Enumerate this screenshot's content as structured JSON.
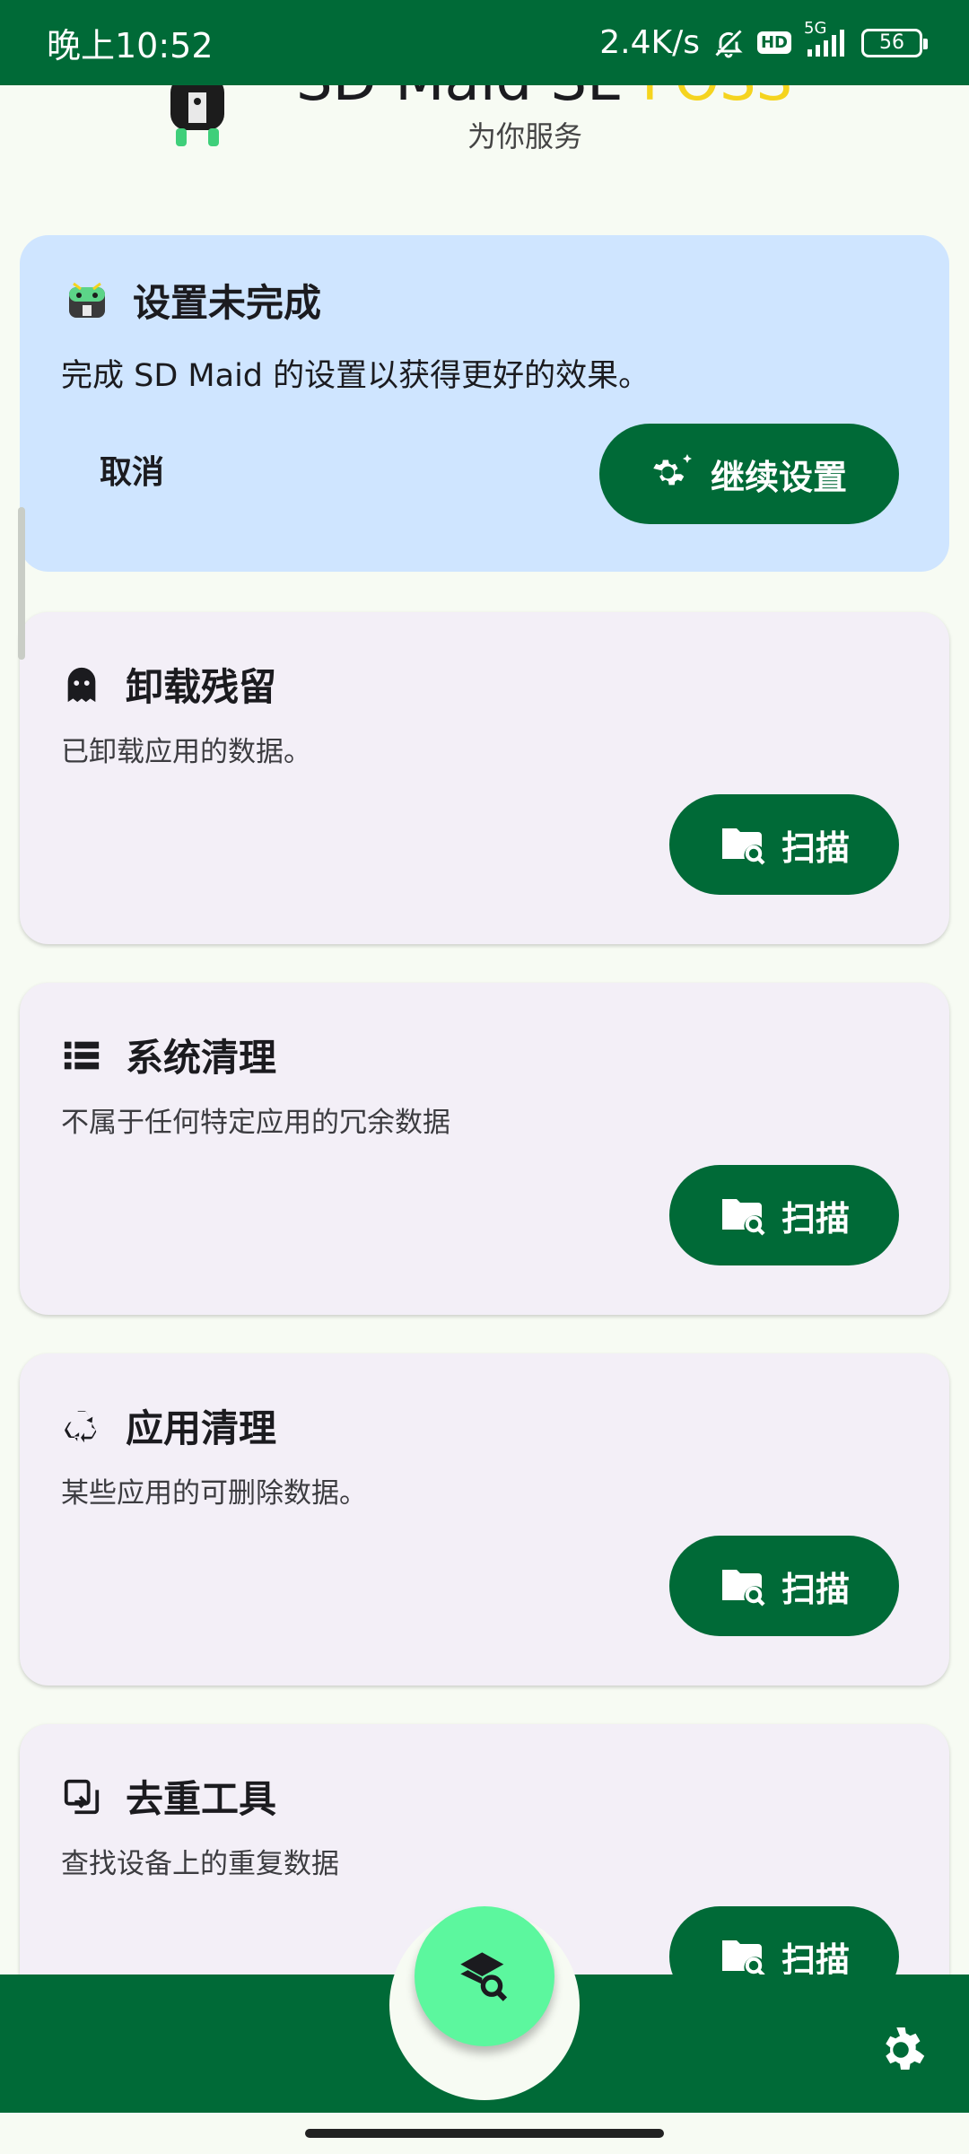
{
  "status_bar": {
    "time": "晚上10:52",
    "net_speed": "2.4K/s",
    "hd_badge": "HD",
    "signal_label": "5G",
    "battery": "56"
  },
  "header": {
    "title_main": "SD Maid SE ",
    "title_accent": "FOSS",
    "subtitle": "为你服务"
  },
  "setup_card": {
    "title": "设置未完成",
    "description": "完成 SD Maid 的设置以获得更好的效果。",
    "cancel_label": "取消",
    "continue_label": "继续设置"
  },
  "tools": [
    {
      "title": "卸载残留",
      "description": "已卸载应用的数据。",
      "icon": "ghost-icon",
      "button_label": "扫描"
    },
    {
      "title": "系统清理",
      "description": "不属于任何特定应用的冗余数据",
      "icon": "list-icon",
      "button_label": "扫描"
    },
    {
      "title": "应用清理",
      "description": "某些应用的可删除数据。",
      "icon": "recycle-icon",
      "button_label": "扫描"
    },
    {
      "title": "去重工具",
      "description": "查找设备上的重复数据",
      "icon": "duplicate-icon",
      "button_label": "扫描"
    }
  ],
  "colors": {
    "primary": "#006a37",
    "fab": "#5cf79e",
    "setup_card_bg": "#cfe5ff",
    "tool_card_bg": "#f3eff7",
    "accent_foss": "#f5d41e"
  }
}
